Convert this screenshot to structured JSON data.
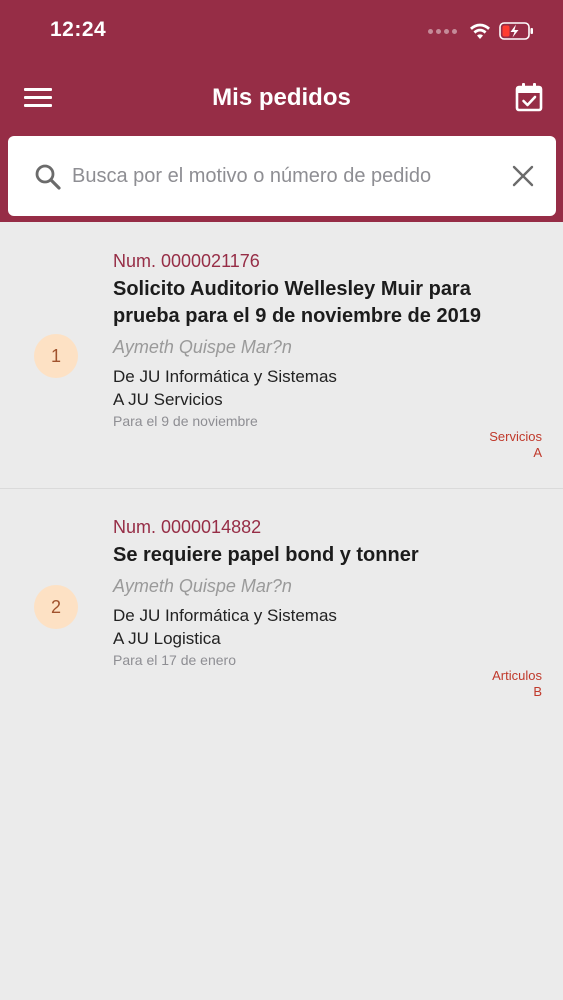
{
  "status_bar": {
    "time": "12:24"
  },
  "header": {
    "title": "Mis pedidos"
  },
  "search": {
    "placeholder": "Busca por el motivo o número de pedido",
    "value": ""
  },
  "colors": {
    "brand": "#962d46",
    "badge": "#fde1c4",
    "category": "#c0392b",
    "background": "#ebebeb"
  },
  "icons": {
    "menu": "menu-icon",
    "calendar": "calendar-check-icon",
    "search": "search-icon",
    "clear": "close-icon"
  },
  "orders": [
    {
      "index": "1",
      "number": "Num. 0000021176",
      "subject": "Solicito Auditorio Wellesley Muir para prueba para el 9 de noviembre de 2019",
      "requester": "Aymeth  Quispe Mar?n",
      "from": "De JU Informática y Sistemas",
      "to": "A JU Servicios",
      "due": "Para el 9 de noviembre",
      "category": "Servicios",
      "level": "A"
    },
    {
      "index": "2",
      "number": "Num. 0000014882",
      "subject": "Se requiere papel bond y tonner",
      "requester": "Aymeth  Quispe Mar?n",
      "from": "De JU Informática y Sistemas",
      "to": "A JU Logistica",
      "due": "Para el 17 de enero",
      "category": "Articulos",
      "level": "B"
    }
  ]
}
